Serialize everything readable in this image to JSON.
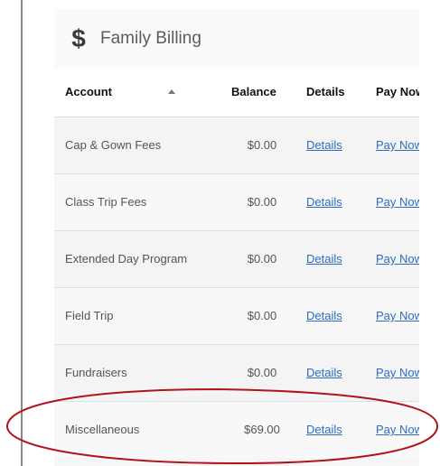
{
  "panel": {
    "icon": "dollar-icon",
    "icon_glyph": "$",
    "title": "Family Billing"
  },
  "table": {
    "columns": [
      {
        "label": "Account",
        "sort": "ascending"
      },
      {
        "label": "Balance"
      },
      {
        "label": "Details"
      },
      {
        "label": "Pay Now"
      }
    ],
    "rows": [
      {
        "account": "Cap & Gown Fees",
        "balance": "$0.00",
        "details": "Details",
        "pay_now": "Pay Now"
      },
      {
        "account": "Class Trip Fees",
        "balance": "$0.00",
        "details": "Details",
        "pay_now": "Pay Now"
      },
      {
        "account": "Extended Day Program",
        "balance": "$0.00",
        "details": "Details",
        "pay_now": "Pay Now"
      },
      {
        "account": "Field Trip",
        "balance": "$0.00",
        "details": "Details",
        "pay_now": "Pay Now"
      },
      {
        "account": "Fundraisers",
        "balance": "$0.00",
        "details": "Details",
        "pay_now": "Pay Now"
      },
      {
        "account": "Miscellaneous",
        "balance": "$69.00",
        "details": "Details",
        "pay_now": "Pay Now"
      }
    ]
  },
  "annotation": {
    "highlight": "red-ellipse",
    "color": "#b0141a"
  },
  "colors": {
    "link": "#2d6cc0",
    "header_text": "#111111",
    "cell_text": "#555555"
  }
}
